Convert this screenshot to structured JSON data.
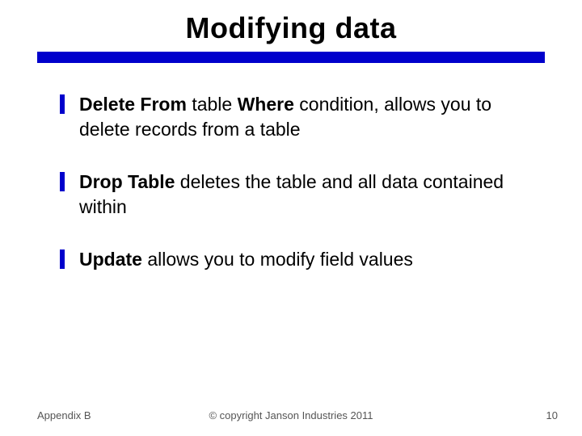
{
  "title": "Modifying data",
  "bullets": [
    {
      "bold1": "Delete From",
      "plain1": " table ",
      "bold2": "Where",
      "plain2": " condition, allows you to delete records from a table"
    },
    {
      "bold1": "Drop Table",
      "plain1": " deletes the table and all data contained within",
      "bold2": "",
      "plain2": ""
    },
    {
      "bold1": "Update",
      "plain1": " allows you to modify field values",
      "bold2": "",
      "plain2": ""
    }
  ],
  "footer": {
    "left": "Appendix B",
    "center": "© copyright Janson Industries 2011",
    "right": "10"
  }
}
